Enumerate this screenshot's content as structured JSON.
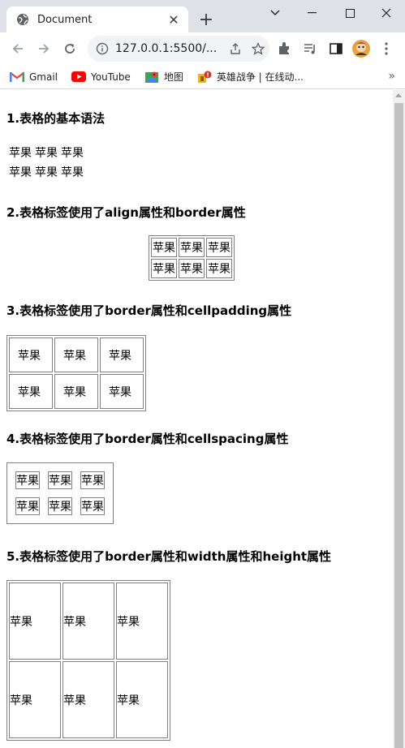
{
  "browser": {
    "tab_title": "Document",
    "new_tab": "+",
    "url": "127.0.0.1:5500/...",
    "bookmarks": [
      {
        "label": "Gmail",
        "icon": "gmail-icon"
      },
      {
        "label": "YouTube",
        "icon": "youtube-icon"
      },
      {
        "label": "地图",
        "icon": "maps-icon"
      },
      {
        "label": "英雄战争 | 在线动...",
        "icon": "game-icon"
      }
    ],
    "more_bookmarks": "»"
  },
  "page": {
    "section1": {
      "heading": "1.表格的基本语法",
      "rows": [
        [
          "苹果",
          "苹果",
          "苹果"
        ],
        [
          "苹果",
          "苹果",
          "苹果"
        ]
      ]
    },
    "section2": {
      "heading": "2.表格标签使用了align属性和border属性",
      "rows": [
        [
          "苹果",
          "苹果",
          "苹果"
        ],
        [
          "苹果",
          "苹果",
          "苹果"
        ]
      ]
    },
    "section3": {
      "heading": "3.表格标签使用了border属性和cellpadding属性",
      "rows": [
        [
          "苹果",
          "苹果",
          "苹果"
        ],
        [
          "苹果",
          "苹果",
          "苹果"
        ]
      ]
    },
    "section4": {
      "heading": "4.表格标签使用了border属性和cellspacing属性",
      "rows": [
        [
          "苹果",
          "苹果",
          "苹果"
        ],
        [
          "苹果",
          "苹果",
          "苹果"
        ]
      ]
    },
    "section5": {
      "heading": "5.表格标签使用了border属性和width属性和height属性",
      "rows": [
        [
          "苹果",
          "苹果",
          "苹果"
        ],
        [
          "苹果",
          "苹果",
          "苹果"
        ]
      ]
    }
  }
}
